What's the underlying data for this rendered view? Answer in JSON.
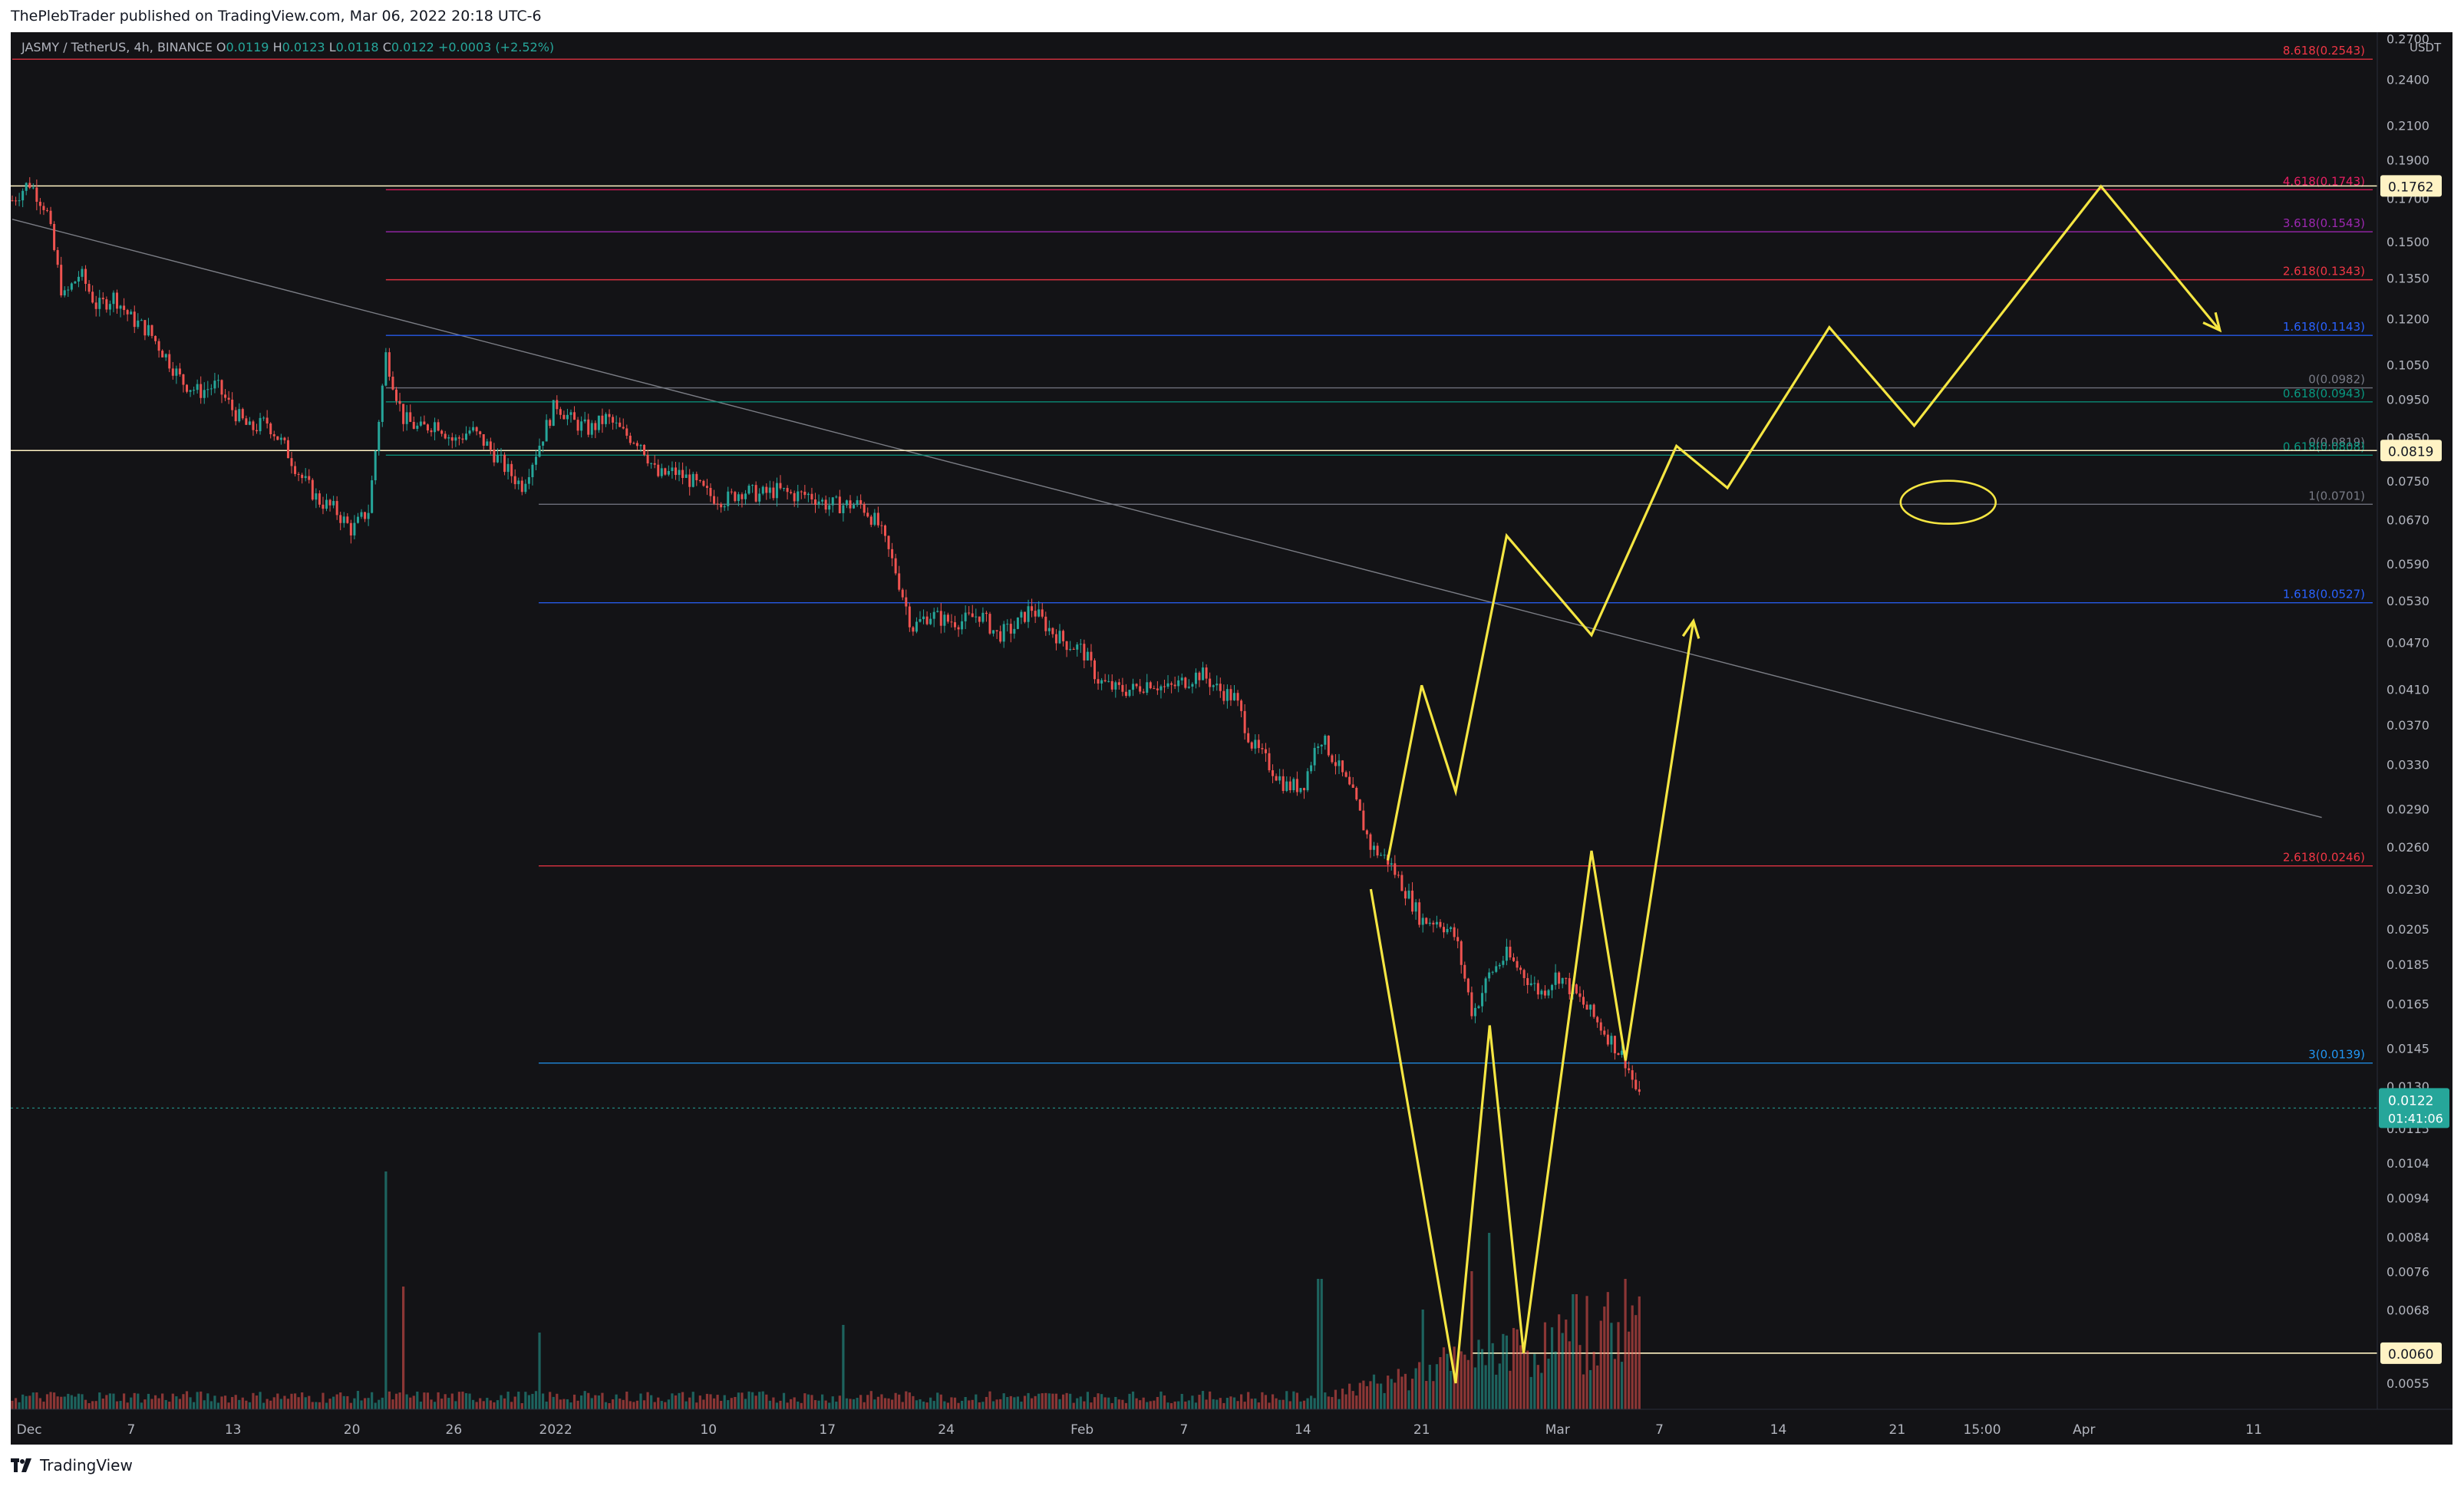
{
  "header": {
    "published": "ThePlebTrader published on TradingView.com, Mar 06, 2022 20:18 UTC-6"
  },
  "legend": {
    "symbol": "JASMY / TetherUS, 4h, BINANCE",
    "o_label": "O",
    "o": "0.0119",
    "h_label": "H",
    "h": "0.0123",
    "l_label": "L",
    "l": "0.0118",
    "c_label": "C",
    "c": "0.0122",
    "change": "+0.0003 (+2.52%)"
  },
  "footer": {
    "brand": "TradingView"
  },
  "colors": {
    "background": "#131316",
    "up": "#26a69a",
    "down": "#ef5350",
    "projection": "#f5e642",
    "axis_text": "#b2b5be",
    "last_price_badge": "#26a69a",
    "level_badge": "#fff3c4"
  },
  "chart_data": {
    "type": "candlestick",
    "symbol": "JASMY / TetherUS",
    "interval": "4h",
    "exchange": "BINANCE",
    "y_scale": "log",
    "y_unit": "USDT",
    "ylim": [
      0.0051,
      0.275
    ],
    "grid": false,
    "x_ticks": [
      {
        "label": "Dec",
        "date": "2021-12-01"
      },
      {
        "label": "7",
        "date": "2021-12-07"
      },
      {
        "label": "13",
        "date": "2021-12-13"
      },
      {
        "label": "20",
        "date": "2021-12-20"
      },
      {
        "label": "26",
        "date": "2021-12-26"
      },
      {
        "label": "2022",
        "date": "2022-01-01"
      },
      {
        "label": "10",
        "date": "2022-01-10"
      },
      {
        "label": "17",
        "date": "2022-01-17"
      },
      {
        "label": "24",
        "date": "2022-01-24"
      },
      {
        "label": "Feb",
        "date": "2022-02-01"
      },
      {
        "label": "7",
        "date": "2022-02-07"
      },
      {
        "label": "14",
        "date": "2022-02-14"
      },
      {
        "label": "21",
        "date": "2022-02-21"
      },
      {
        "label": "Mar",
        "date": "2022-03-01"
      },
      {
        "label": "7",
        "date": "2022-03-07"
      },
      {
        "label": "14",
        "date": "2022-03-14"
      },
      {
        "label": "21",
        "date": "2022-03-21"
      },
      {
        "label": "15:00",
        "date": "2022-03-26"
      },
      {
        "label": "Apr",
        "date": "2022-04-01"
      },
      {
        "label": "11",
        "date": "2022-04-11"
      }
    ],
    "y_ticks": [
      "0.2700",
      "0.2400",
      "0.2100",
      "0.1900",
      "0.1700",
      "0.1500",
      "0.1350",
      "0.1200",
      "0.1050",
      "0.0950",
      "0.0850",
      "0.0750",
      "0.0670",
      "0.0590",
      "0.0530",
      "0.0470",
      "0.0410",
      "0.0370",
      "0.0330",
      "0.0290",
      "0.0260",
      "0.0230",
      "0.0205",
      "0.0185",
      "0.0165",
      "0.0145",
      "0.0130",
      "0.0115",
      "0.0104",
      "0.0094",
      "0.0084",
      "0.0076",
      "0.0068",
      "0.0060",
      "0.0055"
    ],
    "price_path": [
      {
        "date": "2021-11-30",
        "price": 0.169
      },
      {
        "date": "2021-12-01",
        "price": 0.178
      },
      {
        "date": "2021-12-02",
        "price": 0.165
      },
      {
        "date": "2021-12-03",
        "price": 0.127
      },
      {
        "date": "2021-12-04",
        "price": 0.137
      },
      {
        "date": "2021-12-05",
        "price": 0.124
      },
      {
        "date": "2021-12-06",
        "price": 0.128
      },
      {
        "date": "2021-12-07",
        "price": 0.12
      },
      {
        "date": "2021-12-08",
        "price": 0.116
      },
      {
        "date": "2021-12-09",
        "price": 0.108
      },
      {
        "date": "2021-12-10",
        "price": 0.1
      },
      {
        "date": "2021-12-11",
        "price": 0.097
      },
      {
        "date": "2021-12-12",
        "price": 0.099
      },
      {
        "date": "2021-12-13",
        "price": 0.092
      },
      {
        "date": "2021-12-14",
        "price": 0.087
      },
      {
        "date": "2021-12-15",
        "price": 0.089
      },
      {
        "date": "2021-12-16",
        "price": 0.083
      },
      {
        "date": "2021-12-17",
        "price": 0.076
      },
      {
        "date": "2021-12-18",
        "price": 0.071
      },
      {
        "date": "2021-12-19",
        "price": 0.069
      },
      {
        "date": "2021-12-20",
        "price": 0.065
      },
      {
        "date": "2021-12-21",
        "price": 0.069
      },
      {
        "date": "2021-12-22",
        "price": 0.108
      },
      {
        "date": "2021-12-23",
        "price": 0.09
      },
      {
        "date": "2021-12-24",
        "price": 0.087
      },
      {
        "date": "2021-12-25",
        "price": 0.089
      },
      {
        "date": "2021-12-26",
        "price": 0.084
      },
      {
        "date": "2021-12-27",
        "price": 0.087
      },
      {
        "date": "2021-12-28",
        "price": 0.083
      },
      {
        "date": "2021-12-29",
        "price": 0.078
      },
      {
        "date": "2021-12-30",
        "price": 0.074
      },
      {
        "date": "2021-12-31",
        "price": 0.083
      },
      {
        "date": "2022-01-01",
        "price": 0.094
      },
      {
        "date": "2022-01-02",
        "price": 0.089
      },
      {
        "date": "2022-01-03",
        "price": 0.087
      },
      {
        "date": "2022-01-04",
        "price": 0.09
      },
      {
        "date": "2022-01-05",
        "price": 0.086
      },
      {
        "date": "2022-01-06",
        "price": 0.084
      },
      {
        "date": "2022-01-07",
        "price": 0.076
      },
      {
        "date": "2022-01-08",
        "price": 0.077
      },
      {
        "date": "2022-01-09",
        "price": 0.075
      },
      {
        "date": "2022-01-10",
        "price": 0.072
      },
      {
        "date": "2022-01-11",
        "price": 0.071
      },
      {
        "date": "2022-01-12",
        "price": 0.073
      },
      {
        "date": "2022-01-13",
        "price": 0.072
      },
      {
        "date": "2022-01-14",
        "price": 0.073
      },
      {
        "date": "2022-01-15",
        "price": 0.072
      },
      {
        "date": "2022-01-16",
        "price": 0.072
      },
      {
        "date": "2022-01-17",
        "price": 0.07
      },
      {
        "date": "2022-01-18",
        "price": 0.07
      },
      {
        "date": "2022-01-19",
        "price": 0.07
      },
      {
        "date": "2022-01-20",
        "price": 0.066
      },
      {
        "date": "2022-01-21",
        "price": 0.058
      },
      {
        "date": "2022-01-22",
        "price": 0.049
      },
      {
        "date": "2022-01-23",
        "price": 0.051
      },
      {
        "date": "2022-01-24",
        "price": 0.05
      },
      {
        "date": "2022-01-25",
        "price": 0.05
      },
      {
        "date": "2022-01-26",
        "price": 0.051
      },
      {
        "date": "2022-01-27",
        "price": 0.048
      },
      {
        "date": "2022-01-28",
        "price": 0.049
      },
      {
        "date": "2022-01-29",
        "price": 0.052
      },
      {
        "date": "2022-01-30",
        "price": 0.049
      },
      {
        "date": "2022-01-31",
        "price": 0.047
      },
      {
        "date": "2022-02-01",
        "price": 0.046
      },
      {
        "date": "2022-02-02",
        "price": 0.042
      },
      {
        "date": "2022-02-03",
        "price": 0.041
      },
      {
        "date": "2022-02-04",
        "price": 0.041
      },
      {
        "date": "2022-02-05",
        "price": 0.042
      },
      {
        "date": "2022-02-06",
        "price": 0.041
      },
      {
        "date": "2022-02-07",
        "price": 0.042
      },
      {
        "date": "2022-02-08",
        "price": 0.043
      },
      {
        "date": "2022-02-09",
        "price": 0.041
      },
      {
        "date": "2022-02-10",
        "price": 0.04
      },
      {
        "date": "2022-02-11",
        "price": 0.035
      },
      {
        "date": "2022-02-12",
        "price": 0.033
      },
      {
        "date": "2022-02-13",
        "price": 0.031
      },
      {
        "date": "2022-02-14",
        "price": 0.031
      },
      {
        "date": "2022-02-15",
        "price": 0.036
      },
      {
        "date": "2022-02-16",
        "price": 0.033
      },
      {
        "date": "2022-02-17",
        "price": 0.03
      },
      {
        "date": "2022-02-18",
        "price": 0.026
      },
      {
        "date": "2022-02-19",
        "price": 0.025
      },
      {
        "date": "2022-02-20",
        "price": 0.023
      },
      {
        "date": "2022-02-21",
        "price": 0.021
      },
      {
        "date": "2022-02-22",
        "price": 0.021
      },
      {
        "date": "2022-02-23",
        "price": 0.02
      },
      {
        "date": "2022-02-24",
        "price": 0.016
      },
      {
        "date": "2022-02-25",
        "price": 0.018
      },
      {
        "date": "2022-02-26",
        "price": 0.019
      },
      {
        "date": "2022-02-27",
        "price": 0.018
      },
      {
        "date": "2022-02-28",
        "price": 0.017
      },
      {
        "date": "2022-03-01",
        "price": 0.018
      },
      {
        "date": "2022-03-02",
        "price": 0.017
      },
      {
        "date": "2022-03-03",
        "price": 0.016
      },
      {
        "date": "2022-03-04",
        "price": 0.015
      },
      {
        "date": "2022-03-05",
        "price": 0.014
      },
      {
        "date": "2022-03-06",
        "price": 0.0122
      }
    ],
    "fib_levels": [
      {
        "label": "8.618(0.2543)",
        "price": 0.2543,
        "color": "#f23645",
        "start": "2021-11-30"
      },
      {
        "label": "4.618(0.1743)",
        "price": 0.1743,
        "color": "#e91e63",
        "start": "2021-12-22"
      },
      {
        "label": "3.618(0.1543)",
        "price": 0.1543,
        "color": "#9c27b0",
        "start": "2021-12-22"
      },
      {
        "label": "2.618(0.1343)",
        "price": 0.1343,
        "color": "#f23645",
        "start": "2021-12-22"
      },
      {
        "label": "1.618(0.1143)",
        "price": 0.1143,
        "color": "#2962ff",
        "start": "2021-12-22"
      },
      {
        "label": "0(0.0982)",
        "price": 0.0982,
        "color": "#787b86",
        "start": "2021-12-22"
      },
      {
        "label": "0.618(0.0943)",
        "price": 0.0943,
        "color": "#089981",
        "start": "2021-12-22"
      },
      {
        "label": "0(0.0819)",
        "price": 0.0819,
        "color": "#787b86",
        "start": "2021-12-22"
      },
      {
        "label": "0.618(0.0808)",
        "price": 0.0808,
        "color": "#089981",
        "start": "2021-12-22"
      },
      {
        "label": "1(0.0701)",
        "price": 0.0701,
        "color": "#787b86",
        "start": "2021-12-31"
      },
      {
        "label": "1.618(0.0527)",
        "price": 0.0527,
        "color": "#2962ff",
        "start": "2021-12-31"
      },
      {
        "label": "2.618(0.0246)",
        "price": 0.0246,
        "color": "#f23645",
        "start": "2021-12-31"
      },
      {
        "label": "3(0.0139)",
        "price": 0.0139,
        "color": "#2196f3",
        "start": "2021-12-31"
      }
    ],
    "horizontal_lines": [
      {
        "price": 0.1762,
        "label": "0.1762",
        "color": "#fff3c4"
      },
      {
        "price": 0.0819,
        "label": "0.0819",
        "color": "#fff3c4"
      },
      {
        "price": 0.006,
        "label": "0.0060",
        "color": "#fff3c4",
        "start": "2022-02-24"
      }
    ],
    "trendline": {
      "from": {
        "date": "2021-11-30",
        "price": 0.16
      },
      "to": {
        "date": "2022-04-15",
        "price": 0.0283
      }
    },
    "last_price": {
      "label": "0.0122",
      "countdown": "01:41:06",
      "price": 0.0122
    },
    "projection_path": [
      {
        "date": "2022-02-18",
        "price": 0.023
      },
      {
        "date": "2022-02-23",
        "price": 0.0055
      },
      {
        "date": "2022-02-25",
        "price": 0.0155
      },
      {
        "date": "2022-02-27",
        "price": 0.006
      },
      {
        "date": "2022-03-03",
        "price": 0.0257
      },
      {
        "date": "2022-03-05",
        "price": 0.014
      },
      {
        "date": "2022-03-09",
        "price": 0.05
      }
    ],
    "projection_path_2": [
      {
        "date": "2022-02-19",
        "price": 0.025
      },
      {
        "date": "2022-02-21",
        "price": 0.0415
      },
      {
        "date": "2022-02-23",
        "price": 0.0305
      },
      {
        "date": "2022-02-26",
        "price": 0.064
      },
      {
        "date": "2022-03-03",
        "price": 0.048
      },
      {
        "date": "2022-03-08",
        "price": 0.083
      },
      {
        "date": "2022-03-11",
        "price": 0.0735
      },
      {
        "date": "2022-03-17",
        "price": 0.117
      },
      {
        "date": "2022-03-22",
        "price": 0.088
      },
      {
        "date": "2022-04-02",
        "price": 0.176
      },
      {
        "date": "2022-04-09",
        "price": 0.116
      }
    ],
    "ellipse": {
      "date": "2022-03-24",
      "price": 0.0705
    }
  }
}
